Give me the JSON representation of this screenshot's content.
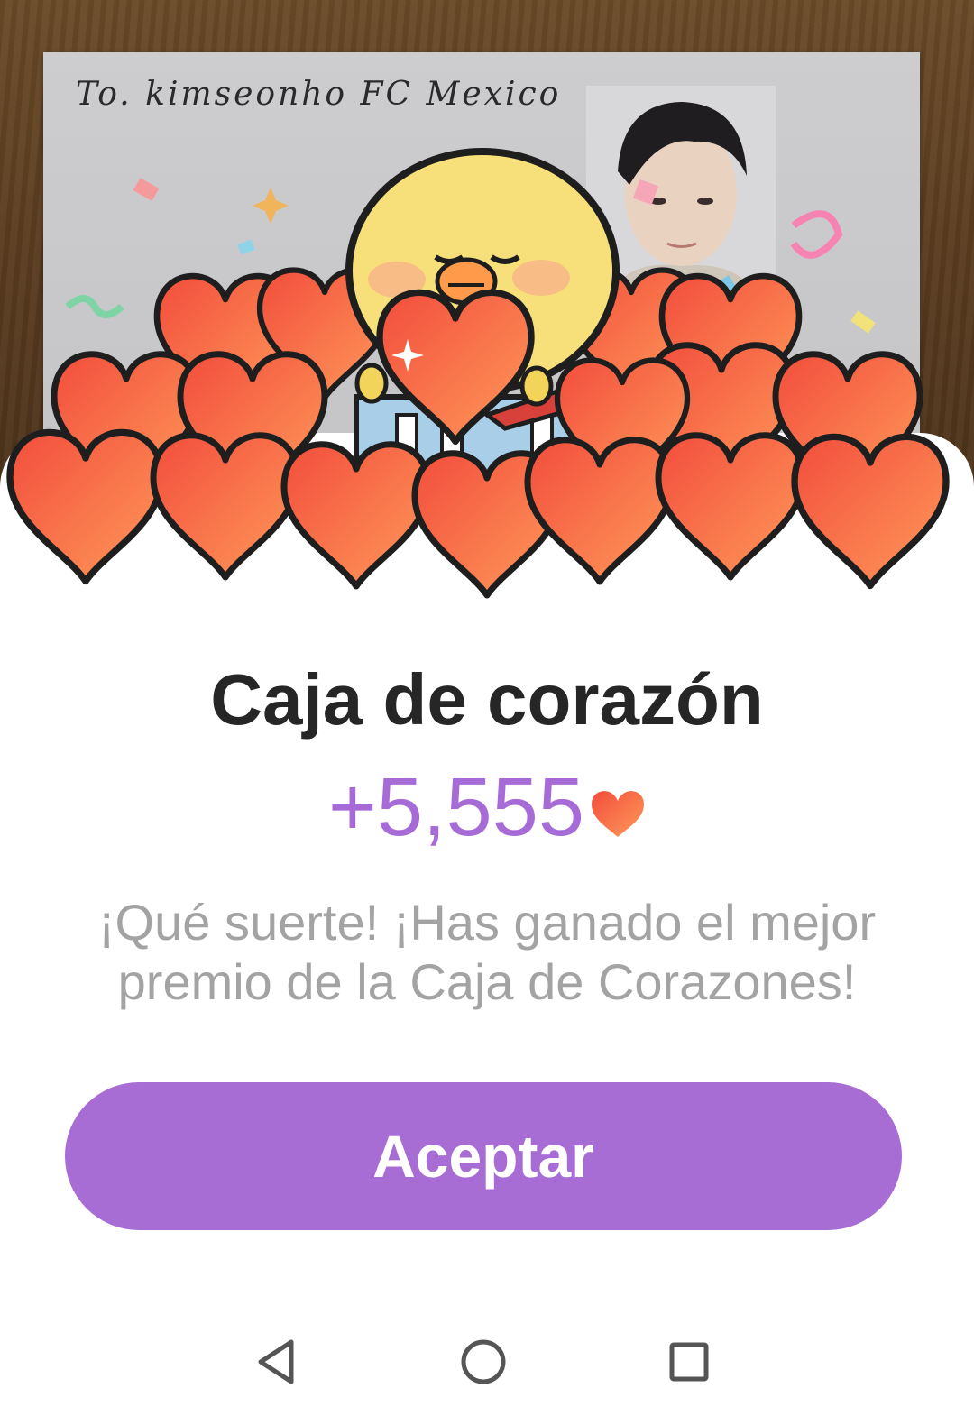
{
  "photo": {
    "handwriting": "To. kimseonho FC Mexico"
  },
  "dialog": {
    "title": "Caja de corazón",
    "reward_amount": "+5,555",
    "message": "¡Qué suerte! ¡Has ganado el mejor premio de la Caja de Corazones!",
    "accept_label": "Aceptar"
  },
  "colors": {
    "accent": "#a86dd4",
    "reward_text": "#a66bd6",
    "heart": "#f56a4a"
  },
  "navbar": {
    "back_icon": "back-triangle-icon",
    "home_icon": "home-circle-icon",
    "recents_icon": "recents-square-icon"
  }
}
